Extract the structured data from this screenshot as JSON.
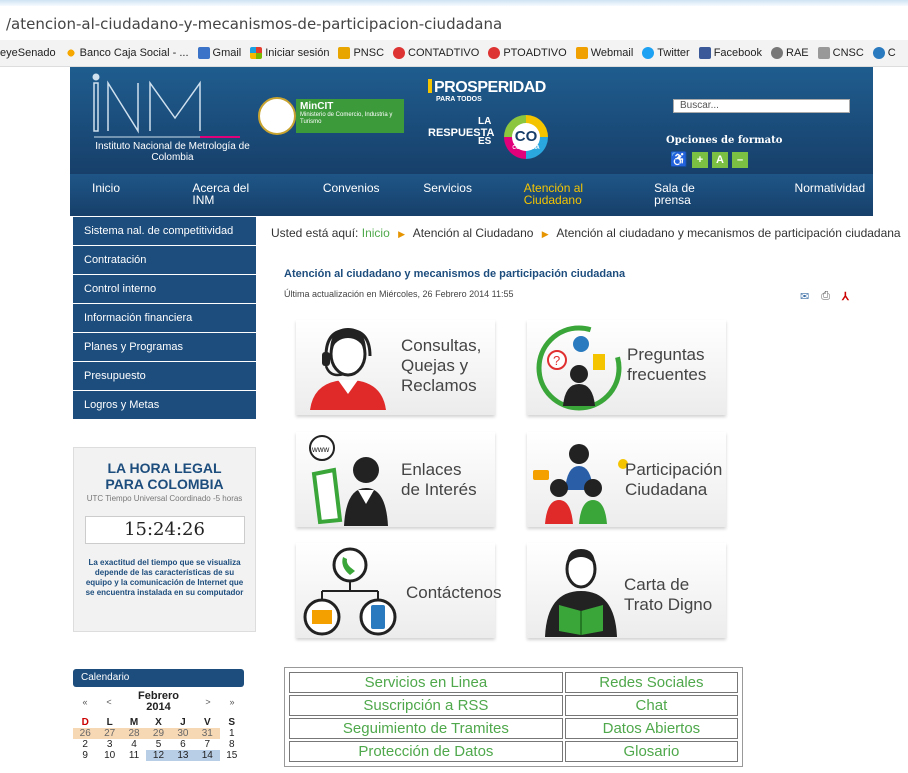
{
  "browser": {
    "url": "/atencion-al-ciudadano-y-mecanismos-de-participacion-ciudadana",
    "bookmarks": [
      {
        "label": "eyeSenado",
        "color": ""
      },
      {
        "label": "Banco Caja Social - ...",
        "color": "#f6a800"
      },
      {
        "label": "Gmail",
        "color": "#3b73c8"
      },
      {
        "label": "Iniciar sesión",
        "color": "#e33d2f"
      },
      {
        "label": "PNSC",
        "color": "#e8a500"
      },
      {
        "label": "CONTADTIVO",
        "color": "#d33"
      },
      {
        "label": "PTOADTIVO",
        "color": "#d33"
      },
      {
        "label": "Webmail",
        "color": "#f0a000"
      },
      {
        "label": "Twitter",
        "color": "#1da1f2"
      },
      {
        "label": "Facebook",
        "color": "#3b5998"
      },
      {
        "label": "RAE",
        "color": "#777"
      },
      {
        "label": "CNSC",
        "color": "#999"
      },
      {
        "label": "C",
        "color": "#2a7abf"
      }
    ]
  },
  "header": {
    "logo_text": "Instituto Nacional de Metrología de Colombia",
    "mincit_title": "MinCIT",
    "mincit_sub": "Ministerio de Comercio, Industria y Turismo",
    "prosperidad": "PROSPERIDAD",
    "para_todos": "PARA TODOS",
    "respuesta": "RESPUESTA",
    "la": "LA",
    "es": "ES",
    "co": "CO",
    "colombia": "COLOMBIA",
    "search_placeholder": "Buscar...",
    "format_options": "Opciones de formato",
    "font_plus": "+",
    "font_reset": "A",
    "font_minus": "–"
  },
  "nav": [
    {
      "label": "Inicio"
    },
    {
      "label": "Acerca del INM"
    },
    {
      "label": "Convenios"
    },
    {
      "label": "Servicios"
    },
    {
      "label": "Atención al Ciudadano",
      "active": true
    },
    {
      "label": "Sala de prensa"
    },
    {
      "label": "Normatividad"
    }
  ],
  "sidebar": [
    "Sistema nal. de competitividad",
    "Contratación",
    "Control interno",
    "Información financiera",
    "Planes y Programas",
    "Presupuesto",
    "Logros y Metas"
  ],
  "clock": {
    "title1": "LA HORA LEGAL",
    "title2": "PARA COLOMBIA",
    "subtitle": "UTC Tiempo Universal Coordinado -5 horas",
    "time": "15:24:26",
    "note": "La exactitud del tiempo que se visualiza depende de las características de su equipo y la comunicación de Internet que se encuentra instalada en su computador"
  },
  "calendar": {
    "title": "Calendario",
    "month": "Febrero",
    "year": "2014",
    "nav": [
      "«",
      "<",
      ">",
      "»"
    ],
    "days": [
      "D",
      "L",
      "M",
      "X",
      "J",
      "V",
      "S"
    ],
    "weeks": [
      [
        "26",
        "27",
        "28",
        "29",
        "30",
        "31",
        "1"
      ],
      [
        "2",
        "3",
        "4",
        "5",
        "6",
        "7",
        "8"
      ],
      [
        "9",
        "10",
        "11",
        "12",
        "13",
        "14",
        "15"
      ]
    ]
  },
  "breadcrumb": {
    "prefix": "Usted está aquí:",
    "items": [
      "Inicio",
      "Atención al Ciudadano",
      "Atención al ciudadano y mecanismos de participación ciudadana"
    ]
  },
  "article": {
    "title": "Atención al ciudadano y mecanismos de participación ciudadana",
    "updated": "Última actualización en Miércoles, 26 Febrero 2014 11:55"
  },
  "tiles": [
    {
      "line1": "Consultas,",
      "line2": "Quejas y",
      "line3": "Reclamos"
    },
    {
      "line1": "Preguntas",
      "line2": "frecuentes"
    },
    {
      "line1": "Enlaces",
      "line2": "de Interés",
      "www": "www"
    },
    {
      "line1": "Participación",
      "line2": "Ciudadana"
    },
    {
      "line1": "Contáctenos"
    },
    {
      "line1": "Carta de",
      "line2": "Trato Digno"
    }
  ],
  "links": [
    [
      "Servicios en Linea",
      "Redes Sociales"
    ],
    [
      "Suscripción a RSS",
      "Chat"
    ],
    [
      "Seguimiento de Tramites",
      "Datos Abiertos"
    ],
    [
      "Protección de Datos",
      "Glosario"
    ]
  ],
  "colors": {
    "nav_blue": "#173f6a",
    "side_blue": "#1d4d7d",
    "link_green": "#4fa84b",
    "active_yellow": "#f4c400",
    "breadcrumb_arrow": "#e69500"
  }
}
